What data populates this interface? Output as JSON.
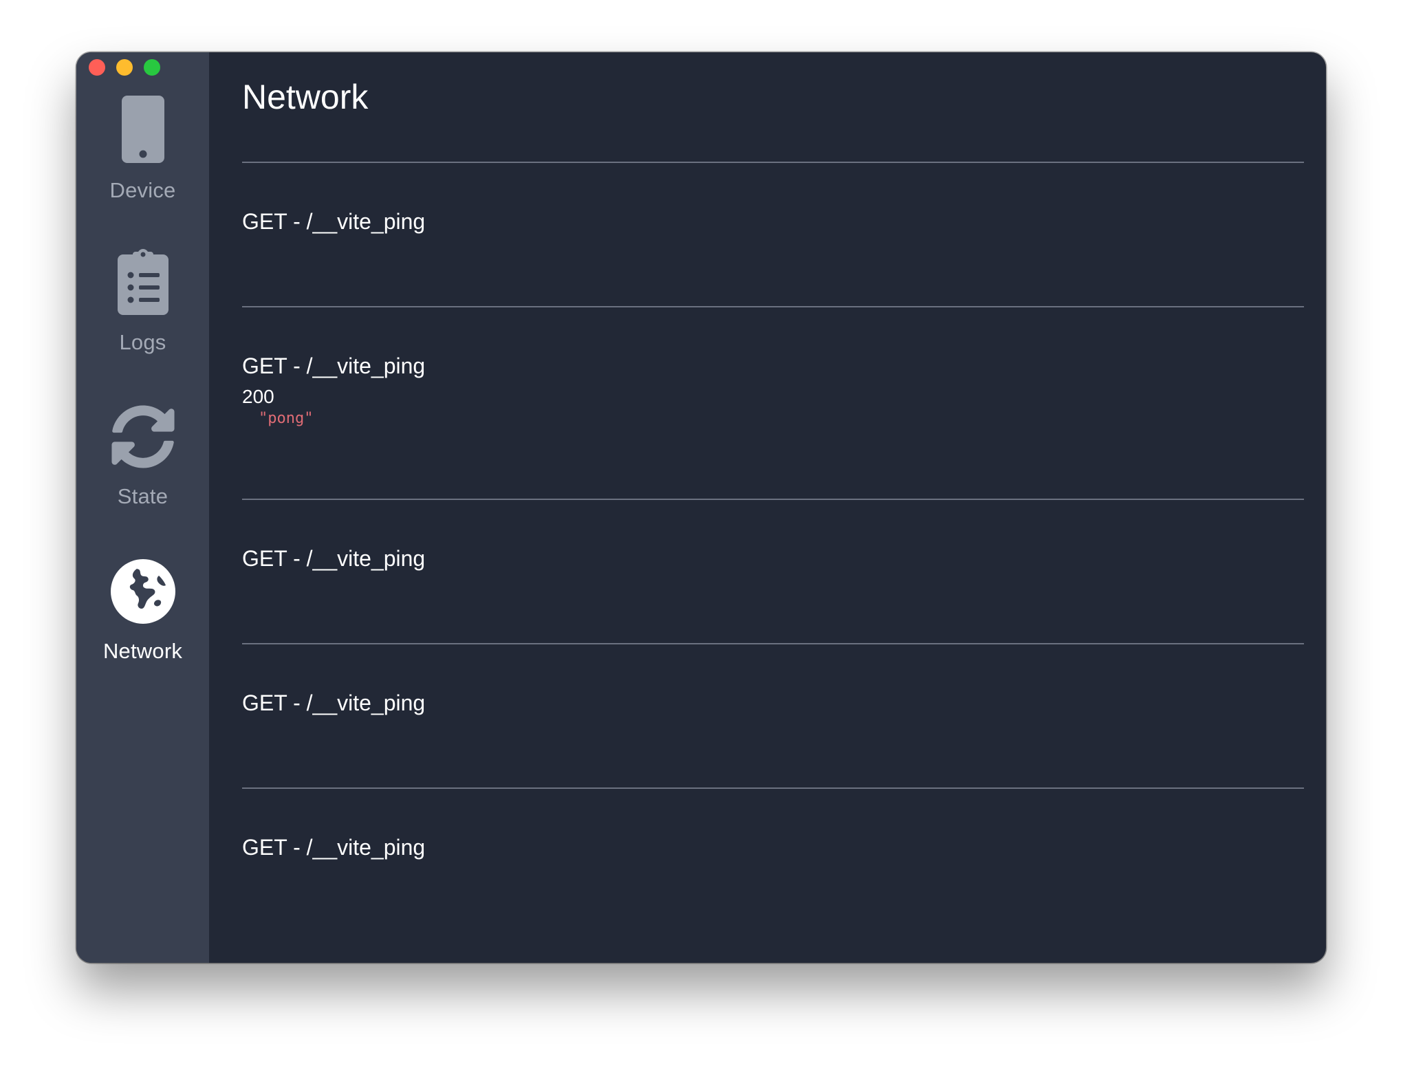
{
  "window": {
    "traffic_colors": {
      "close": "#ff5f57",
      "minimize": "#febc2e",
      "zoom": "#28c840"
    }
  },
  "sidebar": {
    "items": [
      {
        "label": "Device",
        "icon": "phone-icon",
        "active": false
      },
      {
        "label": "Logs",
        "icon": "clipboard-list-icon",
        "active": false
      },
      {
        "label": "State",
        "icon": "sync-icon",
        "active": false
      },
      {
        "label": "Network",
        "icon": "globe-icon",
        "active": true
      }
    ]
  },
  "main": {
    "title": "Network",
    "requests": [
      {
        "line": "GET - /__vite_ping"
      },
      {
        "line": "GET - /__vite_ping",
        "status": "200",
        "body": "\"pong\""
      },
      {
        "line": "GET - /__vite_ping"
      },
      {
        "line": "GET - /__vite_ping"
      },
      {
        "line": "GET - /__vite_ping"
      }
    ]
  },
  "colors": {
    "sidebar_bg": "#394050",
    "main_bg": "#222836",
    "icon_inactive": "#9aa1ad",
    "string_value": "#e06c75"
  }
}
